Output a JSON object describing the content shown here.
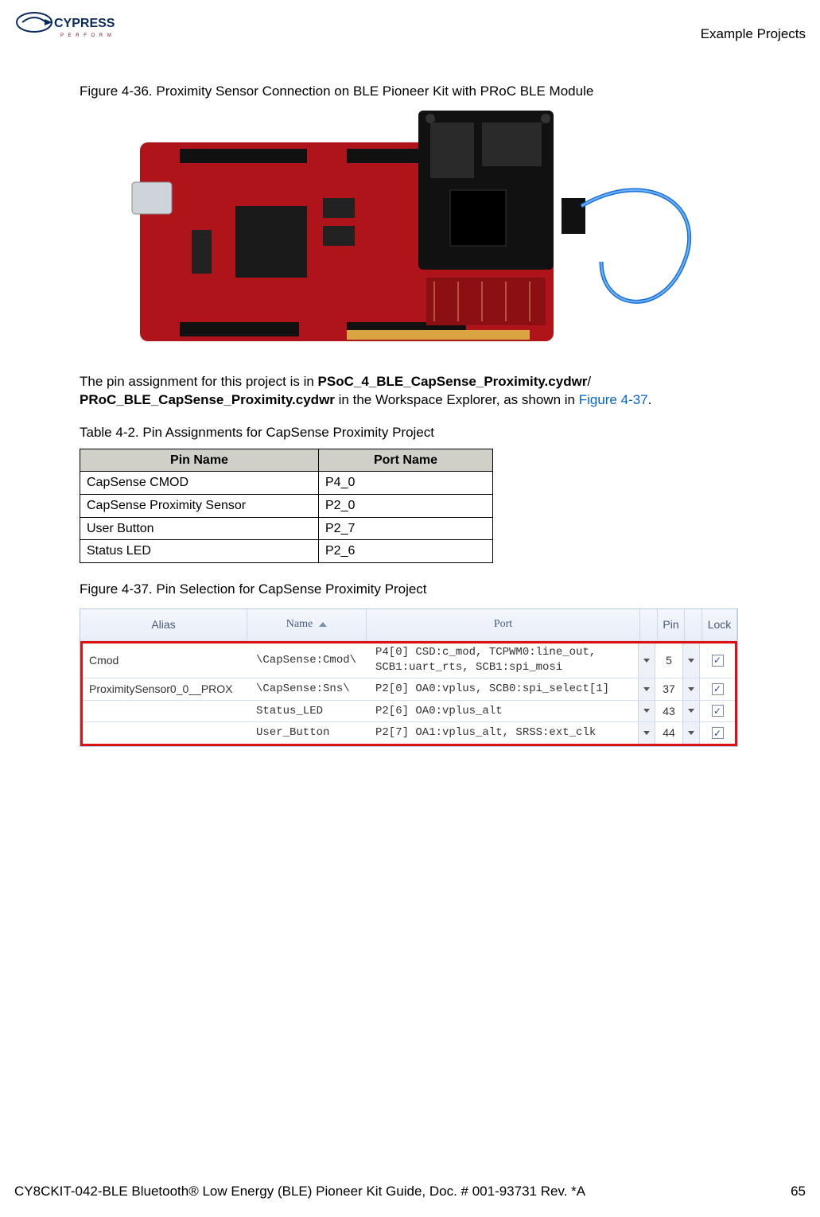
{
  "header": {
    "brand_top": "CYPRESS",
    "brand_sub": "P E R F O R M",
    "section": "Example Projects"
  },
  "fig36": {
    "caption": "Figure 4-36.  Proximity Sensor Connection on BLE Pioneer Kit with PRoC BLE Module"
  },
  "para": {
    "t1": "The pin assignment for this project is in ",
    "b1": "PSoC_4_BLE_CapSense_Proximity.cydwr",
    "slash": "/",
    "b2": "PRoC_BLE_CapSense_Proximity.cydwr",
    "t2": " in the Workspace Explorer, as shown in ",
    "link": "Figure 4-37",
    "dot": "."
  },
  "table42": {
    "caption": "Table 4-2.  Pin Assignments for CapSense Proximity Project",
    "h1": "Pin Name",
    "h2": "Port Name",
    "rows": [
      {
        "pin": "CapSense CMOD",
        "port": "P4_0"
      },
      {
        "pin": "CapSense Proximity Sensor",
        "port": "P2_0"
      },
      {
        "pin": "User Button",
        "port": "P2_7"
      },
      {
        "pin": "Status LED",
        "port": "P2_6"
      }
    ]
  },
  "fig37": {
    "caption": "Figure 4-37.  Pin Selection for CapSense Proximity Project"
  },
  "pinsel": {
    "head": {
      "alias": "Alias",
      "name": "Name",
      "port": "Port",
      "pin": "Pin",
      "lock": "Lock"
    },
    "rows": [
      {
        "alias": "Cmod",
        "name": "\\CapSense:Cmod\\",
        "port": "P4[0] CSD:c_mod, TCPWM0:line_out, SCB1:uart_rts, SCB1:spi_mosi",
        "pin": "5"
      },
      {
        "alias": "ProximitySensor0_0__PROX",
        "name": "\\CapSense:Sns\\",
        "port": "P2[0] OA0:vplus, SCB0:spi_select[1]",
        "pin": "37"
      },
      {
        "alias": "",
        "name": "Status_LED",
        "port": "P2[6] OA0:vplus_alt",
        "pin": "43"
      },
      {
        "alias": "",
        "name": "User_Button",
        "port": "P2[7] OA1:vplus_alt, SRSS:ext_clk",
        "pin": "44"
      }
    ]
  },
  "footer": {
    "doc": "CY8CKIT-042-BLE Bluetooth® Low Energy (BLE) Pioneer Kit Guide, Doc. # 001-93731 Rev. *A",
    "page": "65"
  }
}
